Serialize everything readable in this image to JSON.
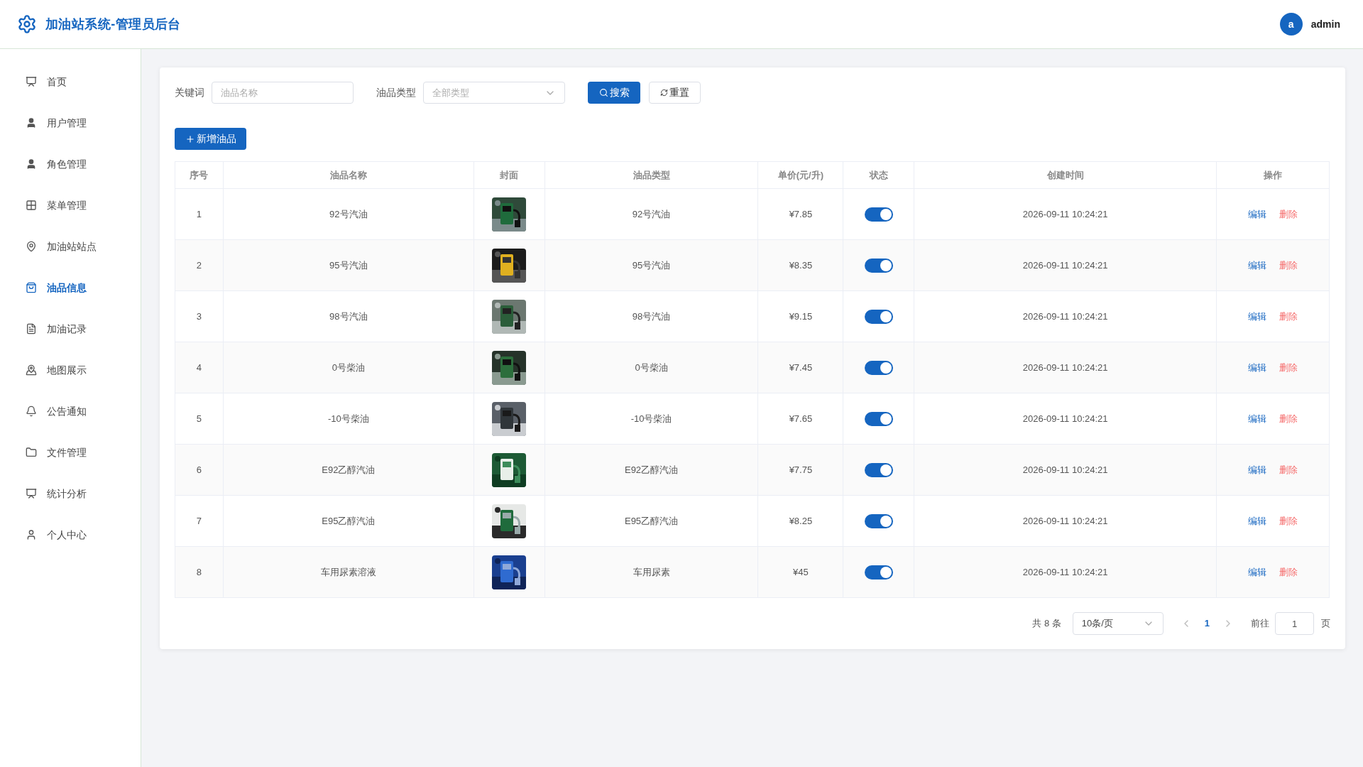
{
  "header": {
    "title": "加油站系统-管理员后台",
    "user": {
      "avatar": "a",
      "name": "admin"
    }
  },
  "sidebar": {
    "items": [
      {
        "label": "首页",
        "selected": false
      },
      {
        "label": "用户管理",
        "selected": false
      },
      {
        "label": "角色管理",
        "selected": false
      },
      {
        "label": "菜单管理",
        "selected": false
      },
      {
        "label": "加油站站点",
        "selected": false
      },
      {
        "label": "油品信息",
        "selected": true
      },
      {
        "label": "加油记录",
        "selected": false
      },
      {
        "label": "地图展示",
        "selected": false
      },
      {
        "label": "公告通知",
        "selected": false
      },
      {
        "label": "文件管理",
        "selected": false
      },
      {
        "label": "统计分析",
        "selected": false
      },
      {
        "label": "个人中心",
        "selected": false
      }
    ]
  },
  "filters": {
    "keyword": {
      "label": "关键词",
      "placeholder": "油品名称"
    },
    "type": {
      "label": "油品类型",
      "placeholder": "全部类型"
    },
    "search_button": "搜索",
    "reset_button": "重置"
  },
  "add_button": "新增油品",
  "table": {
    "columns": [
      "序号",
      "油品名称",
      "封面",
      "油品类型",
      "单价(元/升)",
      "状态",
      "创建时间",
      "操作"
    ],
    "rows": [
      {
        "index": "1",
        "name": "92号汽油",
        "type": "92号汽油",
        "price": "¥7.85",
        "on": true,
        "created": "2026-09-11 10:24:21",
        "actions": [
          "编辑",
          "删除"
        ]
      },
      {
        "index": "2",
        "name": "95号汽油",
        "type": "95号汽油",
        "price": "¥8.35",
        "on": true,
        "created": "2026-09-11 10:24:21",
        "actions": [
          "编辑",
          "删除"
        ]
      },
      {
        "index": "3",
        "name": "98号汽油",
        "type": "98号汽油",
        "price": "¥9.15",
        "on": true,
        "created": "2026-09-11 10:24:21",
        "actions": [
          "编辑",
          "删除"
        ]
      },
      {
        "index": "4",
        "name": "0号柴油",
        "type": "0号柴油",
        "price": "¥7.45",
        "on": true,
        "created": "2026-09-11 10:24:21",
        "actions": [
          "编辑",
          "删除"
        ]
      },
      {
        "index": "5",
        "name": "-10号柴油",
        "type": "-10号柴油",
        "price": "¥7.65",
        "on": true,
        "created": "2026-09-11 10:24:21",
        "actions": [
          "编辑",
          "删除"
        ]
      },
      {
        "index": "6",
        "name": "E92乙醇汽油",
        "type": "E92乙醇汽油",
        "price": "¥7.75",
        "on": true,
        "created": "2026-09-11 10:24:21",
        "actions": [
          "编辑",
          "删除"
        ]
      },
      {
        "index": "7",
        "name": "E95乙醇汽油",
        "type": "E95乙醇汽油",
        "price": "¥8.25",
        "on": true,
        "created": "2026-09-11 10:24:21",
        "actions": [
          "编辑",
          "删除"
        ]
      },
      {
        "index": "8",
        "name": "车用尿素溶液",
        "type": "车用尿素",
        "price": "¥45",
        "on": true,
        "created": "2026-09-11 10:24:21",
        "actions": [
          "编辑",
          "删除"
        ]
      }
    ]
  },
  "pagination": {
    "total": "共 8 条",
    "page_size": "10条/页",
    "pages": [
      {
        "label": "1",
        "selected": true
      }
    ],
    "goto_label": "前往",
    "goto_value": "1",
    "goto_suffix": "页"
  }
}
